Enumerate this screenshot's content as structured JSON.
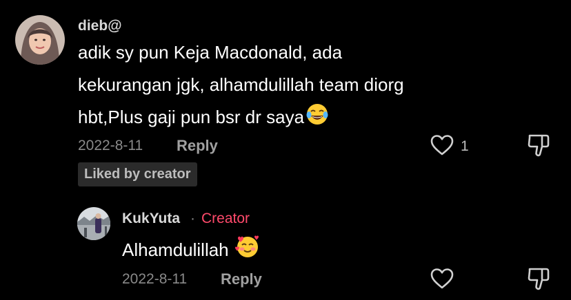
{
  "comment": {
    "username": "dieb@",
    "lines": [
      "adik sy pun Keja Macdonald, ada",
      "kekurangan jgk, alhamdulillah team diorg",
      "hbt,Plus gaji pun bsr dr saya"
    ],
    "emoji": "face-with-tears-of-joy",
    "date": "2022-8-11",
    "reply_label": "Reply",
    "like_count": "1",
    "liked_by_creator": "Liked by creator"
  },
  "reply": {
    "username": "KukYuta",
    "separator": "·",
    "creator_label": "Creator",
    "text": "Alhamdulillah",
    "emoji": "smiling-face-with-hearts",
    "date": "2022-8-11",
    "reply_label": "Reply"
  },
  "colors": {
    "background": "#000000",
    "creator_accent": "#ff4a6b",
    "meta_gray": "#8a8a8a"
  }
}
